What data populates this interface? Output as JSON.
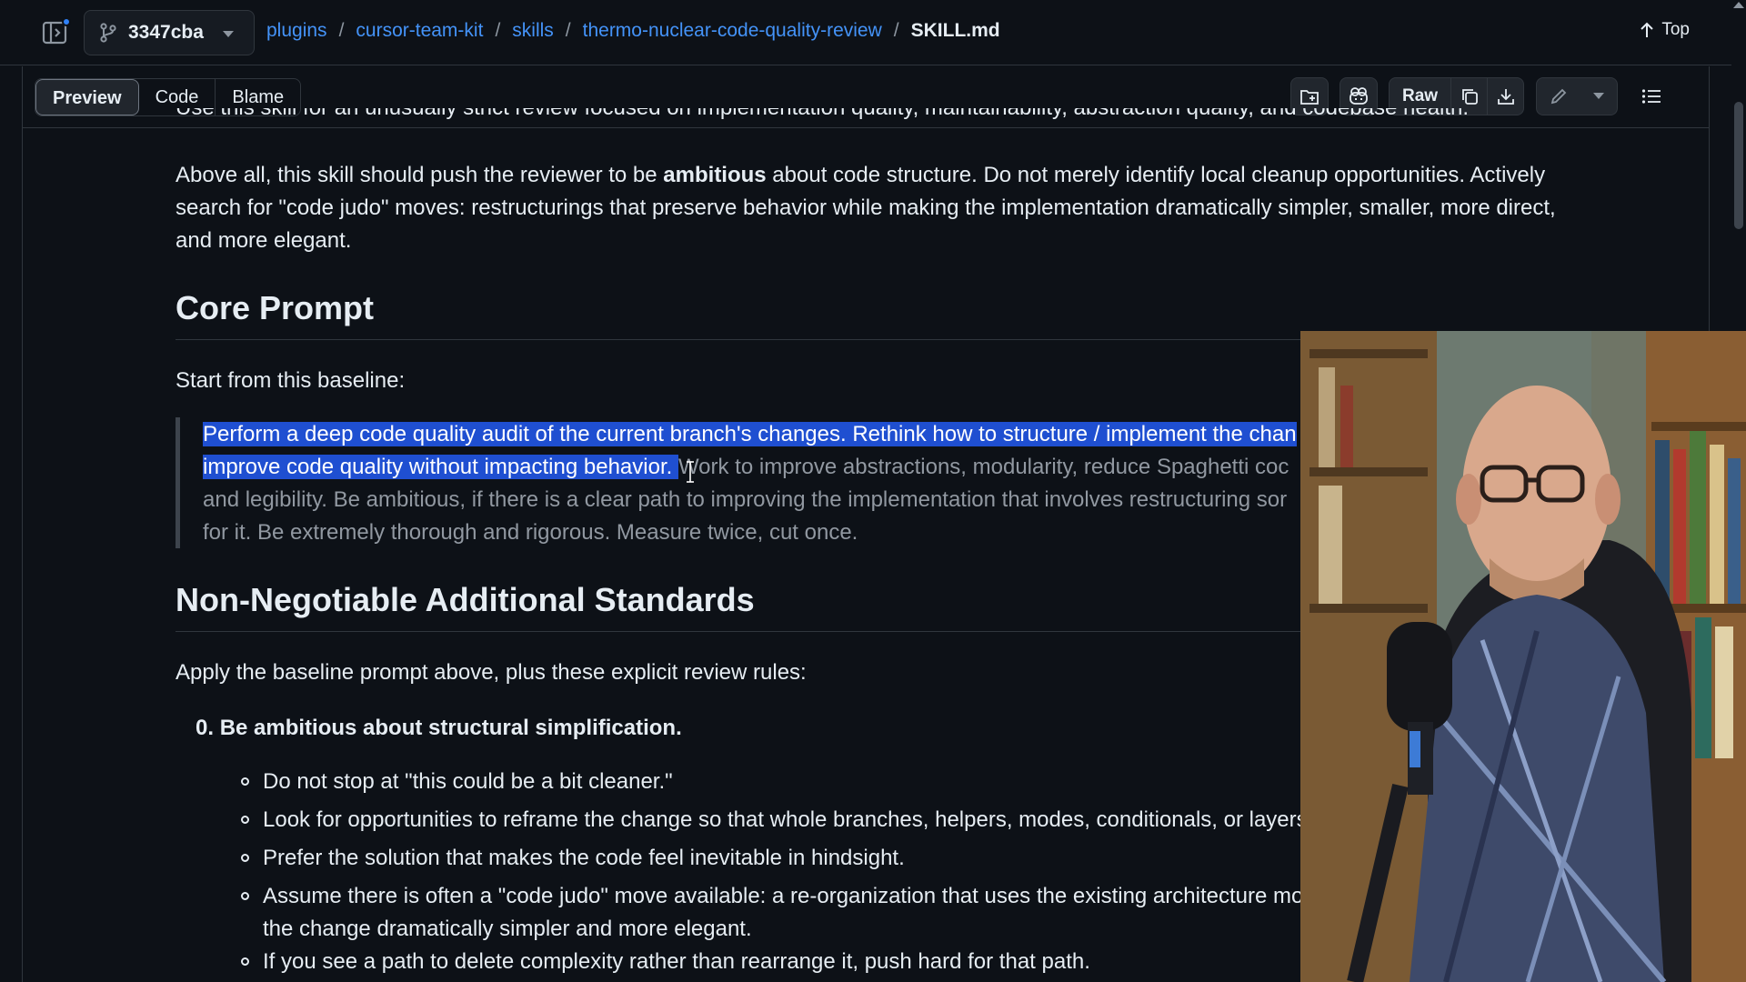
{
  "topbar": {
    "branch": "3347cba",
    "breadcrumb": [
      "plugins",
      "cursor-team-kit",
      "skills",
      "thermo-nuclear-code-quality-review"
    ],
    "separator": "/",
    "current_file": "SKILL.md",
    "top_label": "Top"
  },
  "filebar": {
    "tabs": [
      "Preview",
      "Code",
      "Blame"
    ],
    "active_tab": "Preview",
    "raw_label": "Raw"
  },
  "content": {
    "clipped_line": "Use this skill for an unusually strict review focused on implementation quality, maintainability, abstraction quality, and codebase health.",
    "intro_pre": "Above all, this skill should push the reviewer to be ",
    "intro_bold": "ambitious",
    "intro_post": " about code structure. Do not merely identify local cleanup opportunities. Actively search for \"code judo\" moves: restructurings that preserve behavior while making the implementation dramatically simpler, smaller, more direct, and more elegant.",
    "h_core": "Core Prompt",
    "start_text": "Start from this baseline:",
    "quote_line1_sel": "Perform a deep code quality audit of the current branch's changes. Rethink how to structure / implement the chan",
    "quote_line2_sel": "improve code quality without impacting behavior. ",
    "quote_line2_rest": "Work to improve abstractions, modularity, reduce Spaghetti coc",
    "quote_line3": "and legibility. Be ambitious, if there is a clear path to improving the implementation that involves restructuring sor",
    "quote_line4": "for it. Be extremely thorough and rigorous. Measure twice, cut once.",
    "h_standards": "Non-Negotiable Additional Standards",
    "apply_text": "Apply the baseline prompt above, plus these explicit review rules:",
    "ol_num": "0.",
    "ol_item": "Be ambitious about structural simplification.",
    "bullets": [
      "Do not stop at \"this could be a bit cleaner.\"",
      "Look for opportunities to reframe the change so that whole branches, helpers, modes, conditionals, or layers",
      "Prefer the solution that makes the code feel inevitable in hindsight.",
      "Assume there is often a \"code judo\" move available: a re-organization that uses the existing architecture mo",
      "the change dramatically simpler and more elegant.",
      "If you see a path to delete complexity rather than rearrange it, push hard for that path."
    ]
  },
  "icons": {
    "sidebar": "sidebar-toggle-icon",
    "branch": "git-branch-icon",
    "top_arrow": "arrow-up-icon",
    "folder": "file-directory-icon",
    "copilot": "copilot-icon",
    "copy": "copy-icon",
    "download": "download-icon",
    "edit": "pencil-icon",
    "more": "triangle-down-icon",
    "outline": "list-unordered-icon"
  },
  "colors": {
    "background": "#0d1117",
    "link": "#4493f8",
    "selection": "#1f4fd1",
    "border": "#30363d"
  }
}
